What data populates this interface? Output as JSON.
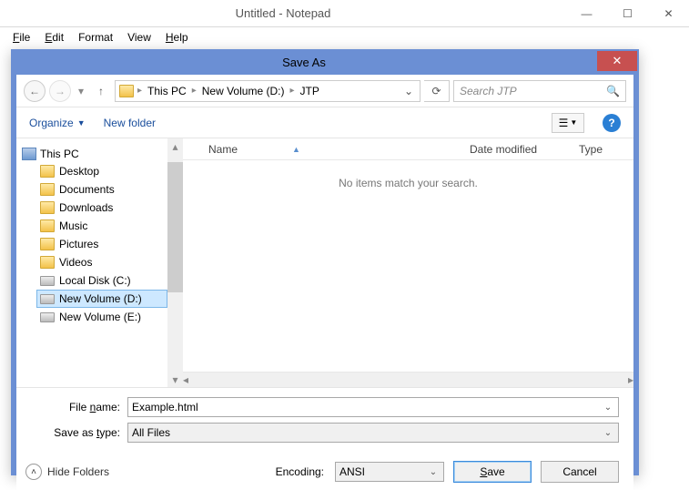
{
  "notepad": {
    "title": "Untitled - Notepad",
    "menu": {
      "file": "File",
      "edit": "Edit",
      "format": "Format",
      "view": "View",
      "help": "Help"
    }
  },
  "dialog": {
    "title": "Save As",
    "breadcrumb": [
      "This PC",
      "New Volume (D:)",
      "JTP"
    ],
    "search_placeholder": "Search JTP",
    "organize": "Organize",
    "new_folder": "New folder",
    "columns": {
      "name": "Name",
      "date": "Date modified",
      "type": "Type"
    },
    "empty": "No items match your search.",
    "tree": {
      "root": "This PC",
      "items": [
        "Desktop",
        "Documents",
        "Downloads",
        "Music",
        "Pictures",
        "Videos",
        "Local Disk (C:)",
        "New Volume (D:)",
        "New Volume (E:)"
      ]
    },
    "filename_label": "File name:",
    "filename_value": "Example.html",
    "savetype_label": "Save as type:",
    "savetype_value": "All Files",
    "hide_folders": "Hide Folders",
    "encoding_label": "Encoding:",
    "encoding_value": "ANSI",
    "save_btn": "Save",
    "cancel_btn": "Cancel"
  }
}
